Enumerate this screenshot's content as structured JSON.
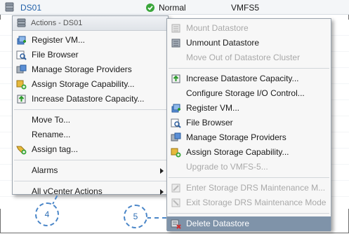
{
  "row": {
    "name": "DS01",
    "status": "Normal",
    "type": "VMFS5"
  },
  "actions_menu": {
    "header": "Actions - DS01",
    "items": [
      {
        "label": "Register VM...",
        "icon": "register-vm-icon"
      },
      {
        "label": "File Browser",
        "icon": "file-browser-icon"
      },
      {
        "label": "Manage Storage Providers",
        "icon": "storage-providers-icon"
      },
      {
        "label": "Assign Storage Capability...",
        "icon": "storage-capability-icon"
      },
      {
        "label": "Increase Datastore Capacity...",
        "icon": "increase-capacity-icon"
      },
      {
        "label": "Move To..."
      },
      {
        "label": "Rename..."
      },
      {
        "label": "Assign tag...",
        "icon": "assign-tag-icon"
      },
      {
        "label": "Alarms"
      },
      {
        "label": "All vCenter Actions"
      }
    ]
  },
  "submenu": {
    "items": [
      {
        "label": "Mount Datastore",
        "disabled": true
      },
      {
        "label": "Unmount Datastore"
      },
      {
        "label": "Move Out of Datastore Cluster",
        "disabled": true
      },
      {
        "label": "Increase Datastore Capacity..."
      },
      {
        "label": "Configure Storage I/O Control..."
      },
      {
        "label": "Register VM..."
      },
      {
        "label": "File Browser"
      },
      {
        "label": "Manage Storage Providers"
      },
      {
        "label": "Assign Storage Capability..."
      },
      {
        "label": "Upgrade to VMFS-5...",
        "disabled": true
      },
      {
        "label": "Enter Storage DRS Maintenance M...",
        "disabled": true
      },
      {
        "label": "Exit Storage DRS Maintenance Mode",
        "disabled": true
      },
      {
        "label": "Delete Datastore",
        "selected": true
      }
    ]
  },
  "callouts": {
    "step4": "4",
    "step5": "5"
  },
  "colors": {
    "selection": "#7f93a9",
    "callout": "#4a86c8",
    "status_ok": "#3aa63a",
    "link": "#1f5fa8"
  }
}
